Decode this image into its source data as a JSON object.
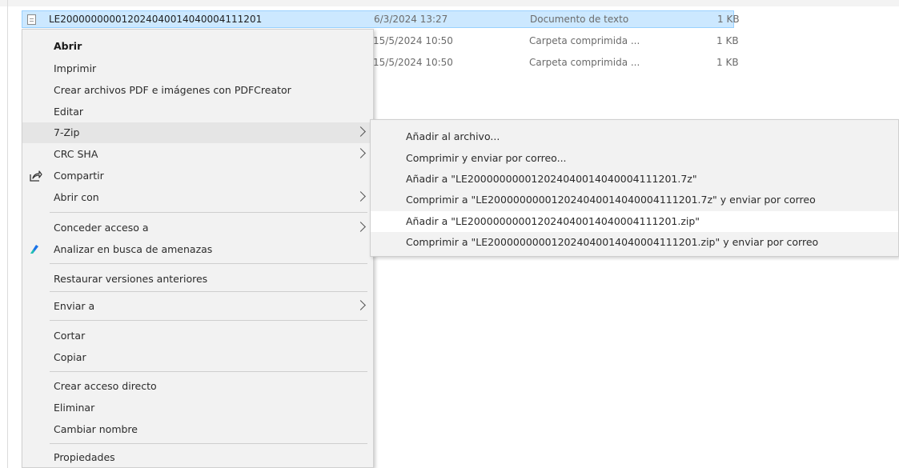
{
  "files": [
    {
      "name": "LE20000000001202404001404000411120​1",
      "date": "6/3/2024 13:27",
      "type": "Documento de texto",
      "size": "1 KB"
    },
    {
      "name": "",
      "date": "15/5/2024 10:50",
      "type": "Carpeta comprimida ...",
      "size": "1 KB"
    },
    {
      "name": "",
      "date": "15/5/2024 10:50",
      "type": "Carpeta comprimida ...",
      "size": "1 KB"
    }
  ],
  "context_menu": {
    "open": "Abrir",
    "print": "Imprimir",
    "pdfcreator": "Crear archivos PDF e imágenes con PDFCreator",
    "edit": "Editar",
    "zip7": "7-Zip",
    "crc_sha": "CRC SHA",
    "share": "Compartir",
    "open_with": "Abrir con",
    "grant_access": "Conceder acceso a",
    "scan": "Analizar en busca de amenazas",
    "restore": "Restaurar versiones anteriores",
    "send_to": "Enviar a",
    "cut": "Cortar",
    "copy": "Copiar",
    "shortcut": "Crear acceso directo",
    "delete": "Eliminar",
    "rename": "Cambiar nombre",
    "properties": "Propiedades"
  },
  "submenu_7zip": {
    "add_archive": "Añadir al archivo...",
    "compress_email": "Comprimir y enviar por correo...",
    "add_7z": "Añadir a \"LE200000000012024040014040004111201.7z\"",
    "compress_7z_email": "Comprimir a \"LE200000000012024040014040004111201.7z\" y enviar por correo",
    "add_zip": "Añadir a \"LE200000000012024040014040004111201.zip\"",
    "compress_zip_email": "Comprimir a \"LE200000000012024040014040004111201.zip\" y enviar por correo"
  },
  "colors": {
    "selection": "#cce8ff",
    "menu_bg": "#f2f2f2",
    "scan_icon": "#1a73e8"
  }
}
